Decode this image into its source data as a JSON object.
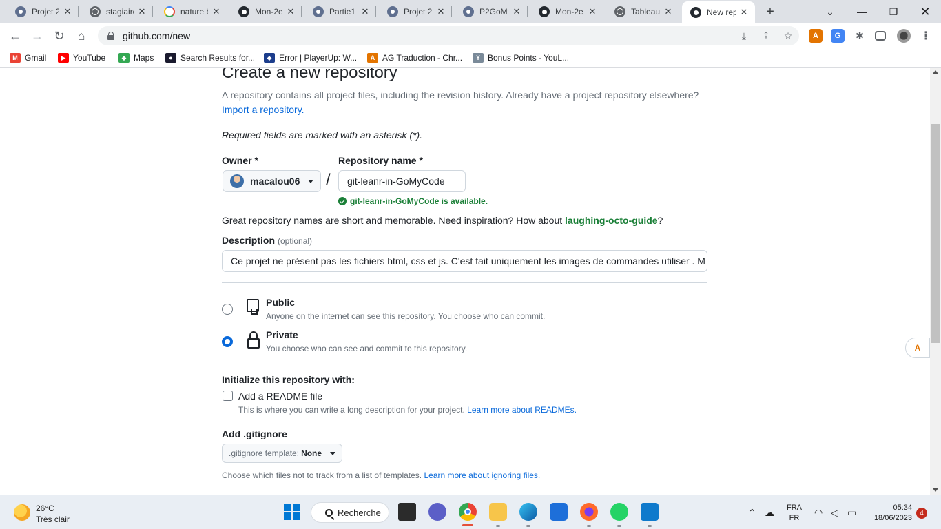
{
  "browser": {
    "tabs": [
      {
        "title": "Projet 2",
        "icon": "ghost"
      },
      {
        "title": "stagiaire",
        "icon": "globe"
      },
      {
        "title": "nature b",
        "icon": "google"
      },
      {
        "title": "Mon-2e",
        "icon": "github"
      },
      {
        "title": "Partie1 c",
        "icon": "ghost"
      },
      {
        "title": "Projet 2",
        "icon": "ghost"
      },
      {
        "title": "P2GoMy",
        "icon": "ghost"
      },
      {
        "title": "Mon-2e",
        "icon": "github"
      },
      {
        "title": "Tableau",
        "icon": "globe"
      },
      {
        "title": "New rep",
        "icon": "github",
        "active": true
      }
    ],
    "url": "github.com/new",
    "bookmarks": [
      {
        "label": "Gmail",
        "color": "#ea4335"
      },
      {
        "label": "YouTube",
        "color": "#ff0000"
      },
      {
        "label": "Maps",
        "color": "#34a853"
      },
      {
        "label": "Search Results for...",
        "color": "#1a1a2e"
      },
      {
        "label": "Error | PlayerUp: W...",
        "color": "#1c3d8c"
      },
      {
        "label": "AG Traduction - Chr...",
        "color": "#e37400"
      },
      {
        "label": "Bonus Points - YouL...",
        "color": "#7a8a99"
      }
    ]
  },
  "page": {
    "title": "Create a new repository",
    "intro": "A repository contains all project files, including the revision history. Already have a project repository elsewhere?",
    "import_link": "Import a repository.",
    "required_note": "Required fields are marked with an asterisk (*).",
    "owner": {
      "label": "Owner *",
      "value": "macalou06"
    },
    "slash": "/",
    "repo_name": {
      "label": "Repository name *",
      "value": "git-leanr-in-GoMyCode",
      "availability": "git-leanr-in-GoMyCode is available."
    },
    "great_names": {
      "text": "Great repository names are short and memorable. Need inspiration? How about ",
      "suggestion": "laughing-octo-guide",
      "end": "?"
    },
    "description": {
      "label": "Description",
      "optional": "(optional)",
      "value": "Ce projet ne présent pas les fichiers html, css et js. C'est fait uniquement les images de commandes utiliser . M"
    },
    "visibility": {
      "public": {
        "title": "Public",
        "desc": "Anyone on the internet can see this repository. You choose who can commit.",
        "selected": false
      },
      "private": {
        "title": "Private",
        "desc": "You choose who can see and commit to this repository.",
        "selected": true
      }
    },
    "initialize": {
      "heading": "Initialize this repository with:",
      "readme_label": "Add a README file",
      "readme_checked": false,
      "readme_desc": "This is where you can write a long description for your project.",
      "readme_link": "Learn more about READMEs."
    },
    "gitignore": {
      "heading": "Add .gitignore",
      "button_prefix": ".gitignore template:",
      "button_value": "None",
      "desc": "Choose which files not to track from a list of templates.",
      "link": "Learn more about ignoring files."
    }
  },
  "taskbar": {
    "weather_temp": "26°C",
    "weather_desc": "Très clair",
    "search_label": "Recherche",
    "lang_top": "FRA",
    "lang_bottom": "FR",
    "time": "05:34",
    "date": "18/06/2023",
    "notifications": "4"
  }
}
